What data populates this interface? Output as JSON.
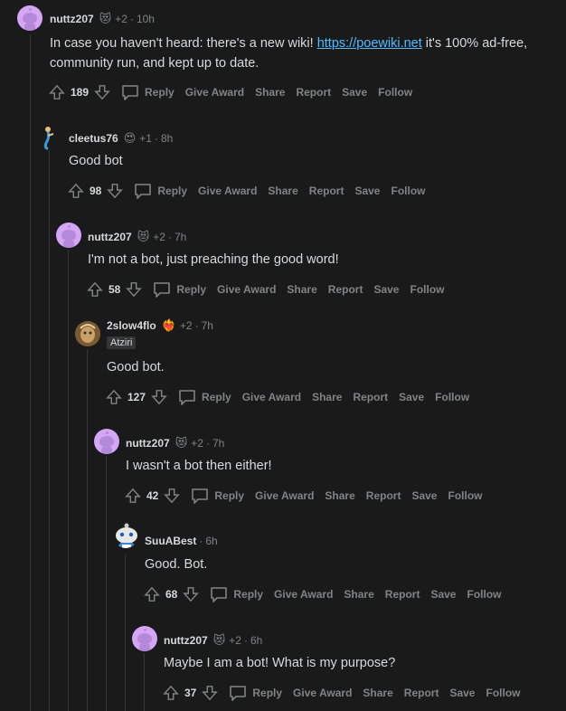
{
  "comments": [
    {
      "user": "nuttz207",
      "award_count": "+2",
      "age": "10h",
      "body_pre": "In case you haven't heard: there's a new wiki! ",
      "link": "https://poewiki.net",
      "body_line1_post": " it's 100% ad-free,",
      "body_line2": "community run, and kept up to date.",
      "score": "189"
    },
    {
      "user": "cleetus76",
      "award_count": "+1",
      "age": "8h",
      "body": "Good bot",
      "score": "98"
    },
    {
      "user": "nuttz207",
      "award_count": "+2",
      "age": "7h",
      "body": "I'm not a bot, just preaching the good word!",
      "score": "58"
    },
    {
      "user": "2slow4flo",
      "award_count": "+2",
      "age": "7h",
      "flair": "Atziri",
      "body": "Good bot.",
      "score": "127"
    },
    {
      "user": "nuttz207",
      "award_count": "+2",
      "age": "7h",
      "body": "I wasn't a bot then either!",
      "score": "42"
    },
    {
      "user": "SuuABest",
      "age": "6h",
      "body": "Good. Bot.",
      "score": "68"
    },
    {
      "user": "nuttz207",
      "award_count": "+2",
      "age": "6h",
      "body": "Maybe I am a bot! What is my purpose?",
      "score": "37"
    }
  ],
  "actions": {
    "reply": "Reply",
    "give_award": "Give Award",
    "share": "Share",
    "report": "Report",
    "save": "Save",
    "follow": "Follow"
  },
  "colors": {
    "background": "#1a1a1b",
    "link": "#4fbcff",
    "muted": "#818384",
    "text": "#d7dadc"
  }
}
